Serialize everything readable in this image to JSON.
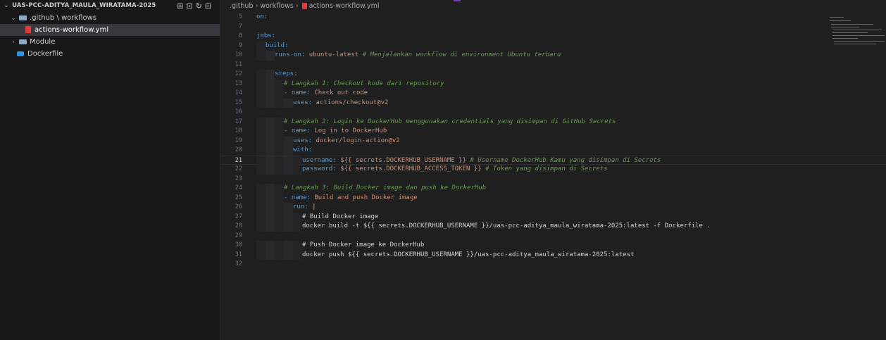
{
  "explorer": {
    "root_label": "UAS-PCC-ADITYA_MAULA_WIRATAMA-2025",
    "items": [
      {
        "label": ".github \\ workflows",
        "type": "folder",
        "expanded": true
      },
      {
        "label": "actions-workflow.yml",
        "type": "yml"
      },
      {
        "label": "Module",
        "type": "folder",
        "expanded": false
      },
      {
        "label": "Dockerfile",
        "type": "docker"
      }
    ]
  },
  "breadcrumb": {
    "part1": ".github",
    "part2": "workflows",
    "part3": "actions-workflow.yml"
  },
  "code": {
    "current_line": "21",
    "lines": [
      {
        "n": "5",
        "text": "on:"
      },
      {
        "n": "7",
        "text": ""
      },
      {
        "n": "8",
        "text": "jobs:"
      },
      {
        "n": "9",
        "text": "build:"
      },
      {
        "n": "10",
        "key": "runs-on:",
        "val": " ubuntu-latest",
        "comment": " # Menjalankan workflow di environment Ubuntu terbaru"
      },
      {
        "n": "11",
        "text": ""
      },
      {
        "n": "12",
        "text": "steps:"
      },
      {
        "n": "13",
        "comment": "# Langkah 1: Checkout kode dari repository"
      },
      {
        "n": "14",
        "key": "- name:",
        "val": " Check out code"
      },
      {
        "n": "15",
        "key": "uses:",
        "val": " actions/checkout@v2"
      },
      {
        "n": "16",
        "text": ""
      },
      {
        "n": "17",
        "comment": "# Langkah 2: Login ke DockerHub menggunakan credentials yang disimpan di GitHub Secrets"
      },
      {
        "n": "18",
        "key": "- name:",
        "val": " Log in to DockerHub"
      },
      {
        "n": "19",
        "key": "uses:",
        "val": " docker/login-action@v2"
      },
      {
        "n": "20",
        "key": "with:",
        "val": ""
      },
      {
        "n": "21",
        "key": "username:",
        "val": " ${{ secrets.DOCKERHUB_USERNAME }}",
        "comment": " # Username DockerHub Kamu yang disimpan di Secrets"
      },
      {
        "n": "22",
        "key": "password:",
        "val": " ${{ secrets.DOCKERHUB_ACCESS_TOKEN }}",
        "comment": " # Token yang disimpan di Secrets"
      },
      {
        "n": "23",
        "text": ""
      },
      {
        "n": "24",
        "comment": "# Langkah 3: Build Docker image dan push ke DockerHub"
      },
      {
        "n": "25",
        "key": "- name:",
        "val": " Build and push Docker image"
      },
      {
        "n": "26",
        "key": "run:",
        "val": " |"
      },
      {
        "n": "27",
        "plain": "# Build Docker image"
      },
      {
        "n": "28",
        "plain": "docker build -t ${{ secrets.DOCKERHUB_USERNAME }}/uas-pcc-aditya_maula_wiratama-2025:latest -f Dockerfile ."
      },
      {
        "n": "29",
        "text": ""
      },
      {
        "n": "30",
        "plain": "# Push Docker image ke DockerHub"
      },
      {
        "n": "31",
        "plain": "docker push ${{ secrets.DOCKERHUB_USERNAME }}/uas-pcc-aditya_maula_wiratama-2025:latest"
      },
      {
        "n": "32",
        "text": ""
      }
    ]
  }
}
